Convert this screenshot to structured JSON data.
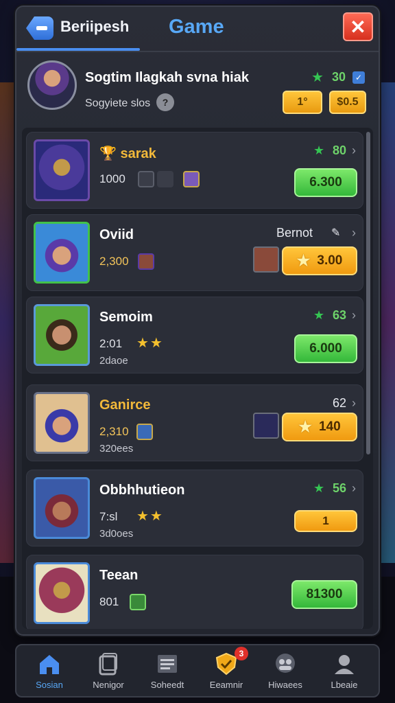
{
  "header": {
    "left_title": "Beriipesh",
    "game_title": "Game",
    "close_label": "✕"
  },
  "profile": {
    "name": "Sogtim Ilagkah svna hiak",
    "subtitle": "Sogyiete slos",
    "sub_icon": "?",
    "score": "30",
    "btn1": "1°",
    "btn2": "$0.5"
  },
  "items": [
    {
      "name": "sarak",
      "line1": "1000",
      "score": "80",
      "button": "6.300",
      "button_type": "green"
    },
    {
      "name": "Oviid",
      "line1": "2,300",
      "tag": "Bernot",
      "button": "3.00",
      "button_type": "gold"
    },
    {
      "name": "Semoim",
      "line1": "2:01",
      "line2": "2daoe",
      "score": "63",
      "button": "6.000",
      "button_type": "green"
    },
    {
      "name": "Ganirce",
      "line1": "2,310",
      "line2": "320ees",
      "tag": "62",
      "button": "140",
      "button_type": "gold"
    },
    {
      "name": "Obbhhutieon",
      "line1": "7:sl",
      "line2": "3d0oes",
      "score": "56",
      "button": "1",
      "button_type": "gold"
    },
    {
      "name": "Teean",
      "line1": "801",
      "button": "81300",
      "button_type": "green"
    }
  ],
  "nav": [
    {
      "label": "Sosian",
      "icon": "home-icon"
    },
    {
      "label": "Nenigor",
      "icon": "cards-icon"
    },
    {
      "label": "Soheedt",
      "icon": "document-icon"
    },
    {
      "label": "Eeamnir",
      "icon": "shield-icon",
      "badge": "3"
    },
    {
      "label": "Hiwaees",
      "icon": "group-icon"
    },
    {
      "label": "Lbeaie",
      "icon": "profile-icon"
    }
  ],
  "colors": {
    "accent": "#58a8f6",
    "green": "#34b83a",
    "gold": "#f09a10",
    "close": "#d6301e"
  }
}
